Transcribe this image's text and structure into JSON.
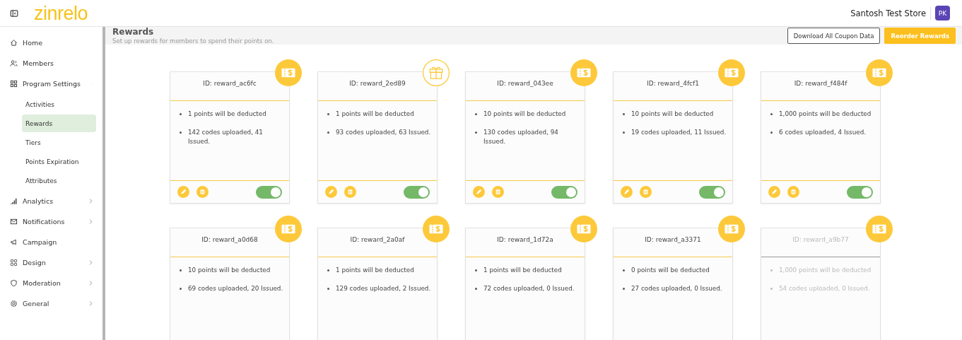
{
  "header": {
    "logo": "zinrelo",
    "store": "Santosh Test Store",
    "avatar": "PK"
  },
  "sidebar": {
    "items": [
      {
        "label": "Home",
        "kind": "home"
      },
      {
        "label": "Members",
        "kind": "members"
      },
      {
        "label": "Program Settings",
        "kind": "grid",
        "expanded": true,
        "children": [
          {
            "label": "Activities",
            "selected": false
          },
          {
            "label": "Rewards",
            "selected": true
          },
          {
            "label": "Tiers",
            "selected": false
          },
          {
            "label": "Points Expiration",
            "selected": false
          },
          {
            "label": "Attributes",
            "selected": false
          }
        ]
      },
      {
        "label": "Analytics",
        "kind": "chart",
        "expanded": false
      },
      {
        "label": "Notifications",
        "kind": "mail",
        "expanded": false
      },
      {
        "label": "Campaign",
        "kind": "megaphone"
      },
      {
        "label": "Design",
        "kind": "blocks",
        "expanded": false
      },
      {
        "label": "Moderation",
        "kind": "shield",
        "expanded": false
      },
      {
        "label": "General",
        "kind": "gear",
        "expanded": false
      }
    ]
  },
  "page": {
    "title": "Rewards",
    "subtitle": "Set up rewards for members to spend their points on.",
    "buttons": [
      {
        "label": "Download All Coupon Data",
        "kind": "outline"
      },
      {
        "label": "Reorder Rewards",
        "kind": "primary"
      }
    ]
  },
  "rewards": [
    {
      "id": "ID: reward_ac6fc",
      "kind": "coupon",
      "disabled": false,
      "lines": [
        "1 points will be deducted",
        "142 codes uploaded, 41 Issued."
      ],
      "on": true
    },
    {
      "id": "ID: reward_2ed89",
      "kind": "gift",
      "disabled": false,
      "lines": [
        "1 points will be deducted",
        "93 codes uploaded, 63 Issued."
      ],
      "on": true
    },
    {
      "id": "ID: reward_043ee",
      "kind": "coupon",
      "disabled": false,
      "lines": [
        "10 points will be deducted",
        "130 codes uploaded, 94 Issued."
      ],
      "on": true
    },
    {
      "id": "ID: reward_4fcf1",
      "kind": "coupon",
      "disabled": false,
      "lines": [
        "10 points will be deducted",
        "19 codes uploaded, 11 Issued."
      ],
      "on": true
    },
    {
      "id": "ID: reward_f484f",
      "kind": "coupon",
      "disabled": false,
      "lines": [
        "1,000 points will be deducted",
        "6 codes uploaded, 4 Issued."
      ],
      "on": true
    },
    {
      "id": "ID: reward_a0d68",
      "kind": "coupon",
      "disabled": false,
      "lines": [
        "10 points will be deducted",
        "69 codes uploaded, 20 Issued."
      ]
    },
    {
      "id": "ID: reward_2a0af",
      "kind": "coupon",
      "disabled": false,
      "lines": [
        "1 points will be deducted",
        "129 codes uploaded, 2 Issued."
      ]
    },
    {
      "id": "ID: reward_1d72a",
      "kind": "coupon",
      "disabled": false,
      "lines": [
        "1 points will be deducted",
        "72 codes uploaded, 0 Issued."
      ]
    },
    {
      "id": "ID: reward_a3371",
      "kind": "coupon",
      "disabled": false,
      "lines": [
        "0 points will be deducted",
        "27 codes uploaded, 0 Issued."
      ]
    },
    {
      "id": "ID: reward_a9b77",
      "kind": "coupon",
      "disabled": true,
      "lines": [
        "1,000 points will be deducted",
        "54 codes uploaded, 0 Issued."
      ]
    }
  ]
}
